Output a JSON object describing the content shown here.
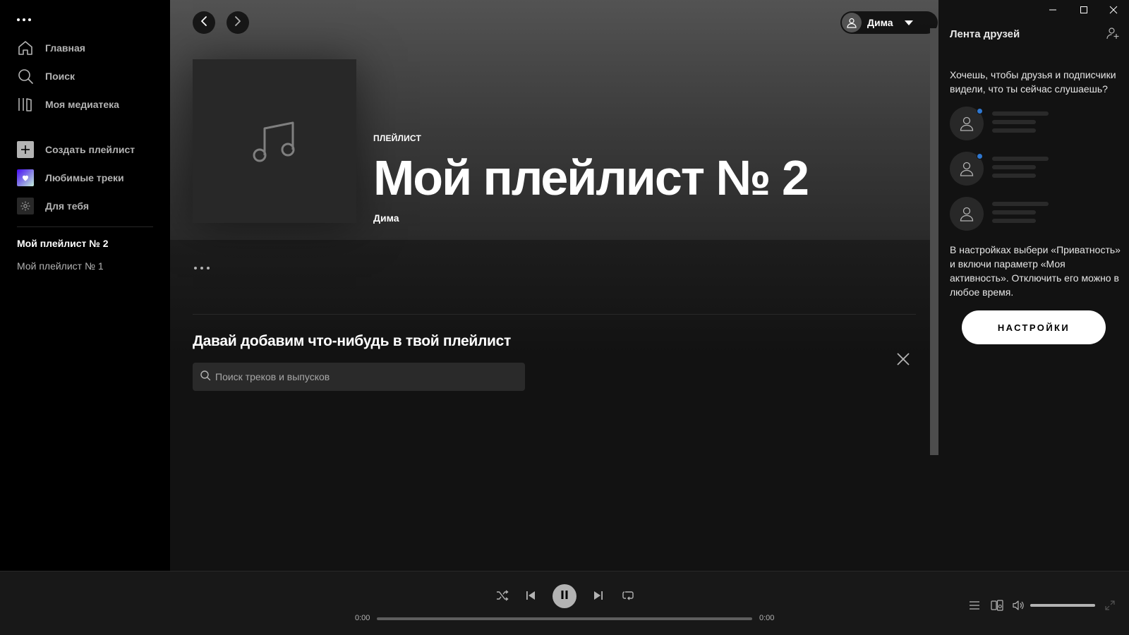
{
  "sidebar": {
    "nav": [
      {
        "label": "Главная",
        "icon": "home-icon"
      },
      {
        "label": "Поиск",
        "icon": "search-icon"
      },
      {
        "label": "Моя медиатека",
        "icon": "library-icon"
      }
    ],
    "actions": [
      {
        "label": "Создать плейлист",
        "icon": "plus-icon"
      },
      {
        "label": "Любимые треки",
        "icon": "heart-icon"
      },
      {
        "label": "Для тебя",
        "icon": "sun-icon"
      }
    ],
    "playlists": [
      "Мой плейлист № 2",
      "Мой плейлист № 1"
    ],
    "active_playlist": "Мой плейлист № 2"
  },
  "header": {
    "user_name": "Дима"
  },
  "playlist": {
    "type": "ПЛЕЙЛИСТ",
    "title": "Мой плейлист № 2",
    "owner": "Дима"
  },
  "add_section": {
    "title": "Давай добавим что-нибудь в твой плейлист",
    "search_placeholder": "Поиск треков и выпусков"
  },
  "friends": {
    "title": "Лента друзей",
    "description": "Хочешь, чтобы друзья и подписчики видели, что ты сейчас слушаешь?",
    "hint": "В настройках выбери «Приватность» и включи параметр «Моя активность». Отключить его можно в любое время.",
    "settings_button": "НАСТРОЙКИ"
  },
  "player": {
    "time_elapsed": "0:00",
    "time_total": "0:00",
    "progress": 0,
    "volume": 1.0
  },
  "colors": {
    "accent_dot": "#2e77d0",
    "background": "#121212",
    "sidebar": "#000000"
  }
}
